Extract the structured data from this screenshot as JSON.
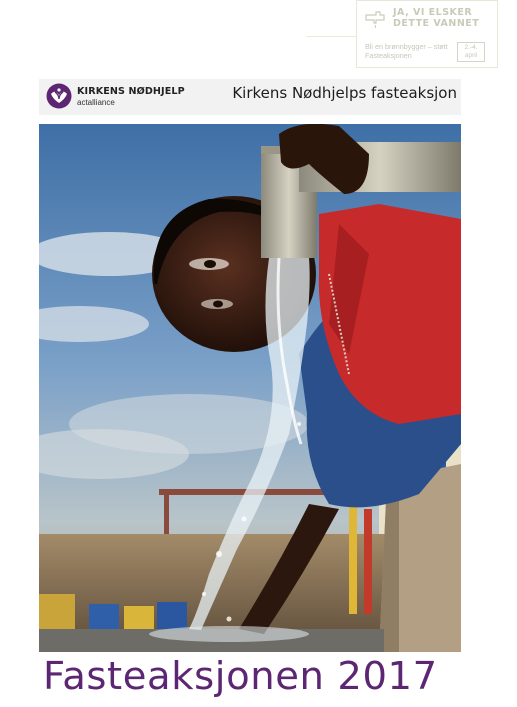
{
  "stamp": {
    "headline": "JA, VI ELSKER DETTE VANNET",
    "subline": "Bli en brønnbygger – støtt Fasteaksjonen",
    "date": "2.-4. april",
    "icon": "tap-icon"
  },
  "header": {
    "org_name": "KIRKENS NØDHJELP",
    "alliance": "actalliance",
    "campaign_title": "Kirkens Nødhjelps fasteaksjon",
    "logo_icon": "dove-hands-logo"
  },
  "photo": {
    "icon": "boy-drinking-from-tap-photo"
  },
  "footer": {
    "title": "Fasteaksjonen 2017"
  },
  "colors": {
    "brand_purple": "#5d2673",
    "header_bg": "#f2f2f3",
    "sky": "#5b86b6"
  }
}
